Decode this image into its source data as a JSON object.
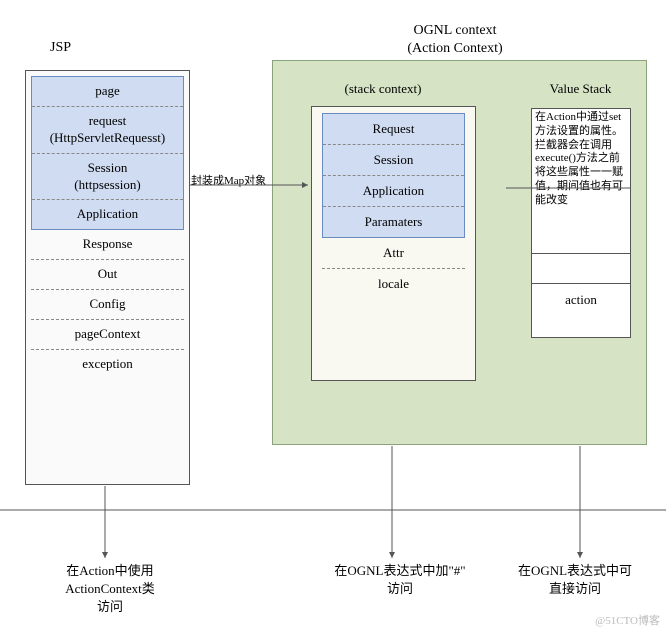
{
  "jsp": {
    "title": "JSP",
    "scope_items": [
      "page",
      "request\n(HttpServletRequesst)",
      "Session\n(httpsession)",
      "Application"
    ],
    "other_items": [
      "Response",
      "Out",
      "Config",
      "pageContext",
      "exception"
    ]
  },
  "ognl": {
    "title_line1": "OGNL context",
    "title_line2": "(Action Context)",
    "stack_title": "(stack context)",
    "stack_scope_items": [
      "Request",
      "Session",
      "Application",
      "Paramaters"
    ],
    "stack_other_items": [
      "Attr",
      "locale"
    ],
    "value_stack_title": "Value Stack",
    "value_stack_note": "在Action中通过set方法设置的属性。拦截器会在调用execute()方法之前将这些属性一一赋值，期间值也有可能改变",
    "value_stack_action": "action"
  },
  "arrow_label": "封装成Map对象",
  "captions": {
    "jsp": "在Action中使用\nActionContext类\n访问",
    "stack": "在OGNL表达式中加\"#\"\n访问",
    "vs": "在OGNL表达式中可\n直接访问"
  },
  "watermark": "@51CTO博客"
}
